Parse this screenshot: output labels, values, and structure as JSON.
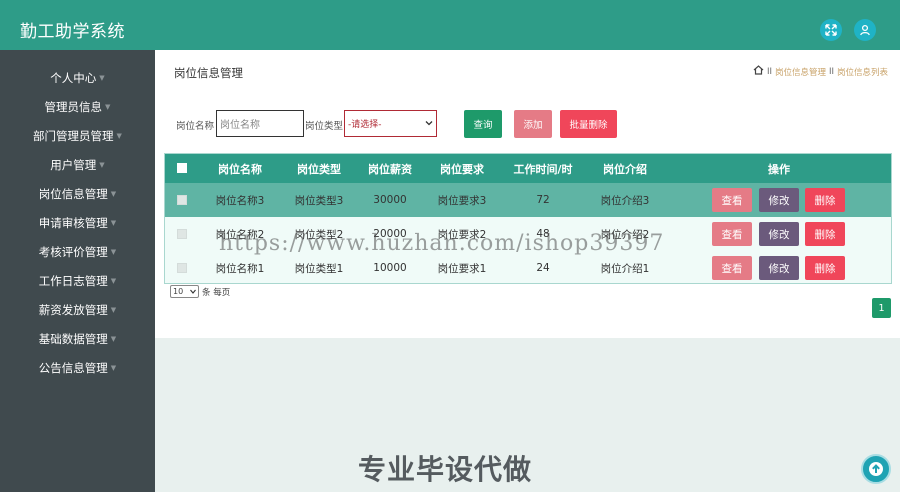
{
  "app": {
    "title": "勤工助学系统"
  },
  "icons": {
    "fullscreen": "fullscreen-icon",
    "user": "user-icon",
    "home": "home-icon",
    "back_to_top": "arrow-up-circle-icon"
  },
  "colors": {
    "primary": "#2e9c88",
    "sidebar": "#404a4e",
    "search": "#1e9a6a",
    "add": "#e57b86",
    "batch_delete": "#f0465a",
    "view": "#e57b86",
    "edit": "#6b5a7c",
    "delete": "#f0465a"
  },
  "sidebar": {
    "items": [
      {
        "label": "个人中心"
      },
      {
        "label": "管理员信息"
      },
      {
        "label": "部门管理员管理"
      },
      {
        "label": "用户管理"
      },
      {
        "label": "岗位信息管理"
      },
      {
        "label": "申请审核管理"
      },
      {
        "label": "考核评价管理"
      },
      {
        "label": "工作日志管理"
      },
      {
        "label": "薪资发放管理"
      },
      {
        "label": "基础数据管理"
      },
      {
        "label": "公告信息管理"
      }
    ]
  },
  "page": {
    "title": "岗位信息管理"
  },
  "breadcrumb": {
    "separator": "II",
    "items": [
      "岗位信息管理",
      "岗位信息列表"
    ]
  },
  "search": {
    "name_label": "岗位名称",
    "name_placeholder": "岗位名称",
    "type_label": "岗位类型",
    "type_selected": "-请选择-",
    "search_button": "查询",
    "add_button": "添加",
    "batch_delete_button": "批量删除"
  },
  "table": {
    "headers": [
      "岗位名称",
      "岗位类型",
      "岗位薪资",
      "岗位要求",
      "工作时间/时",
      "岗位介绍",
      "操作"
    ],
    "rows": [
      {
        "name": "岗位名称3",
        "type": "岗位类型3",
        "salary": "30000",
        "requirement": "岗位要求3",
        "hours": "72",
        "intro": "岗位介绍3"
      },
      {
        "name": "岗位名称2",
        "type": "岗位类型2",
        "salary": "20000",
        "requirement": "岗位要求2",
        "hours": "48",
        "intro": "岗位介绍2"
      },
      {
        "name": "岗位名称1",
        "type": "岗位类型1",
        "salary": "10000",
        "requirement": "岗位要求1",
        "hours": "24",
        "intro": "岗位介绍1"
      }
    ],
    "actions": {
      "view": "查看",
      "edit": "修改",
      "delete": "删除"
    }
  },
  "pagination": {
    "page_size": "10",
    "per_page_label": "条 每页",
    "current_page": "1"
  },
  "overlay": {
    "watermark": "https://www.huzhan.com/ishop39397",
    "promo": "专业毕设代做"
  }
}
